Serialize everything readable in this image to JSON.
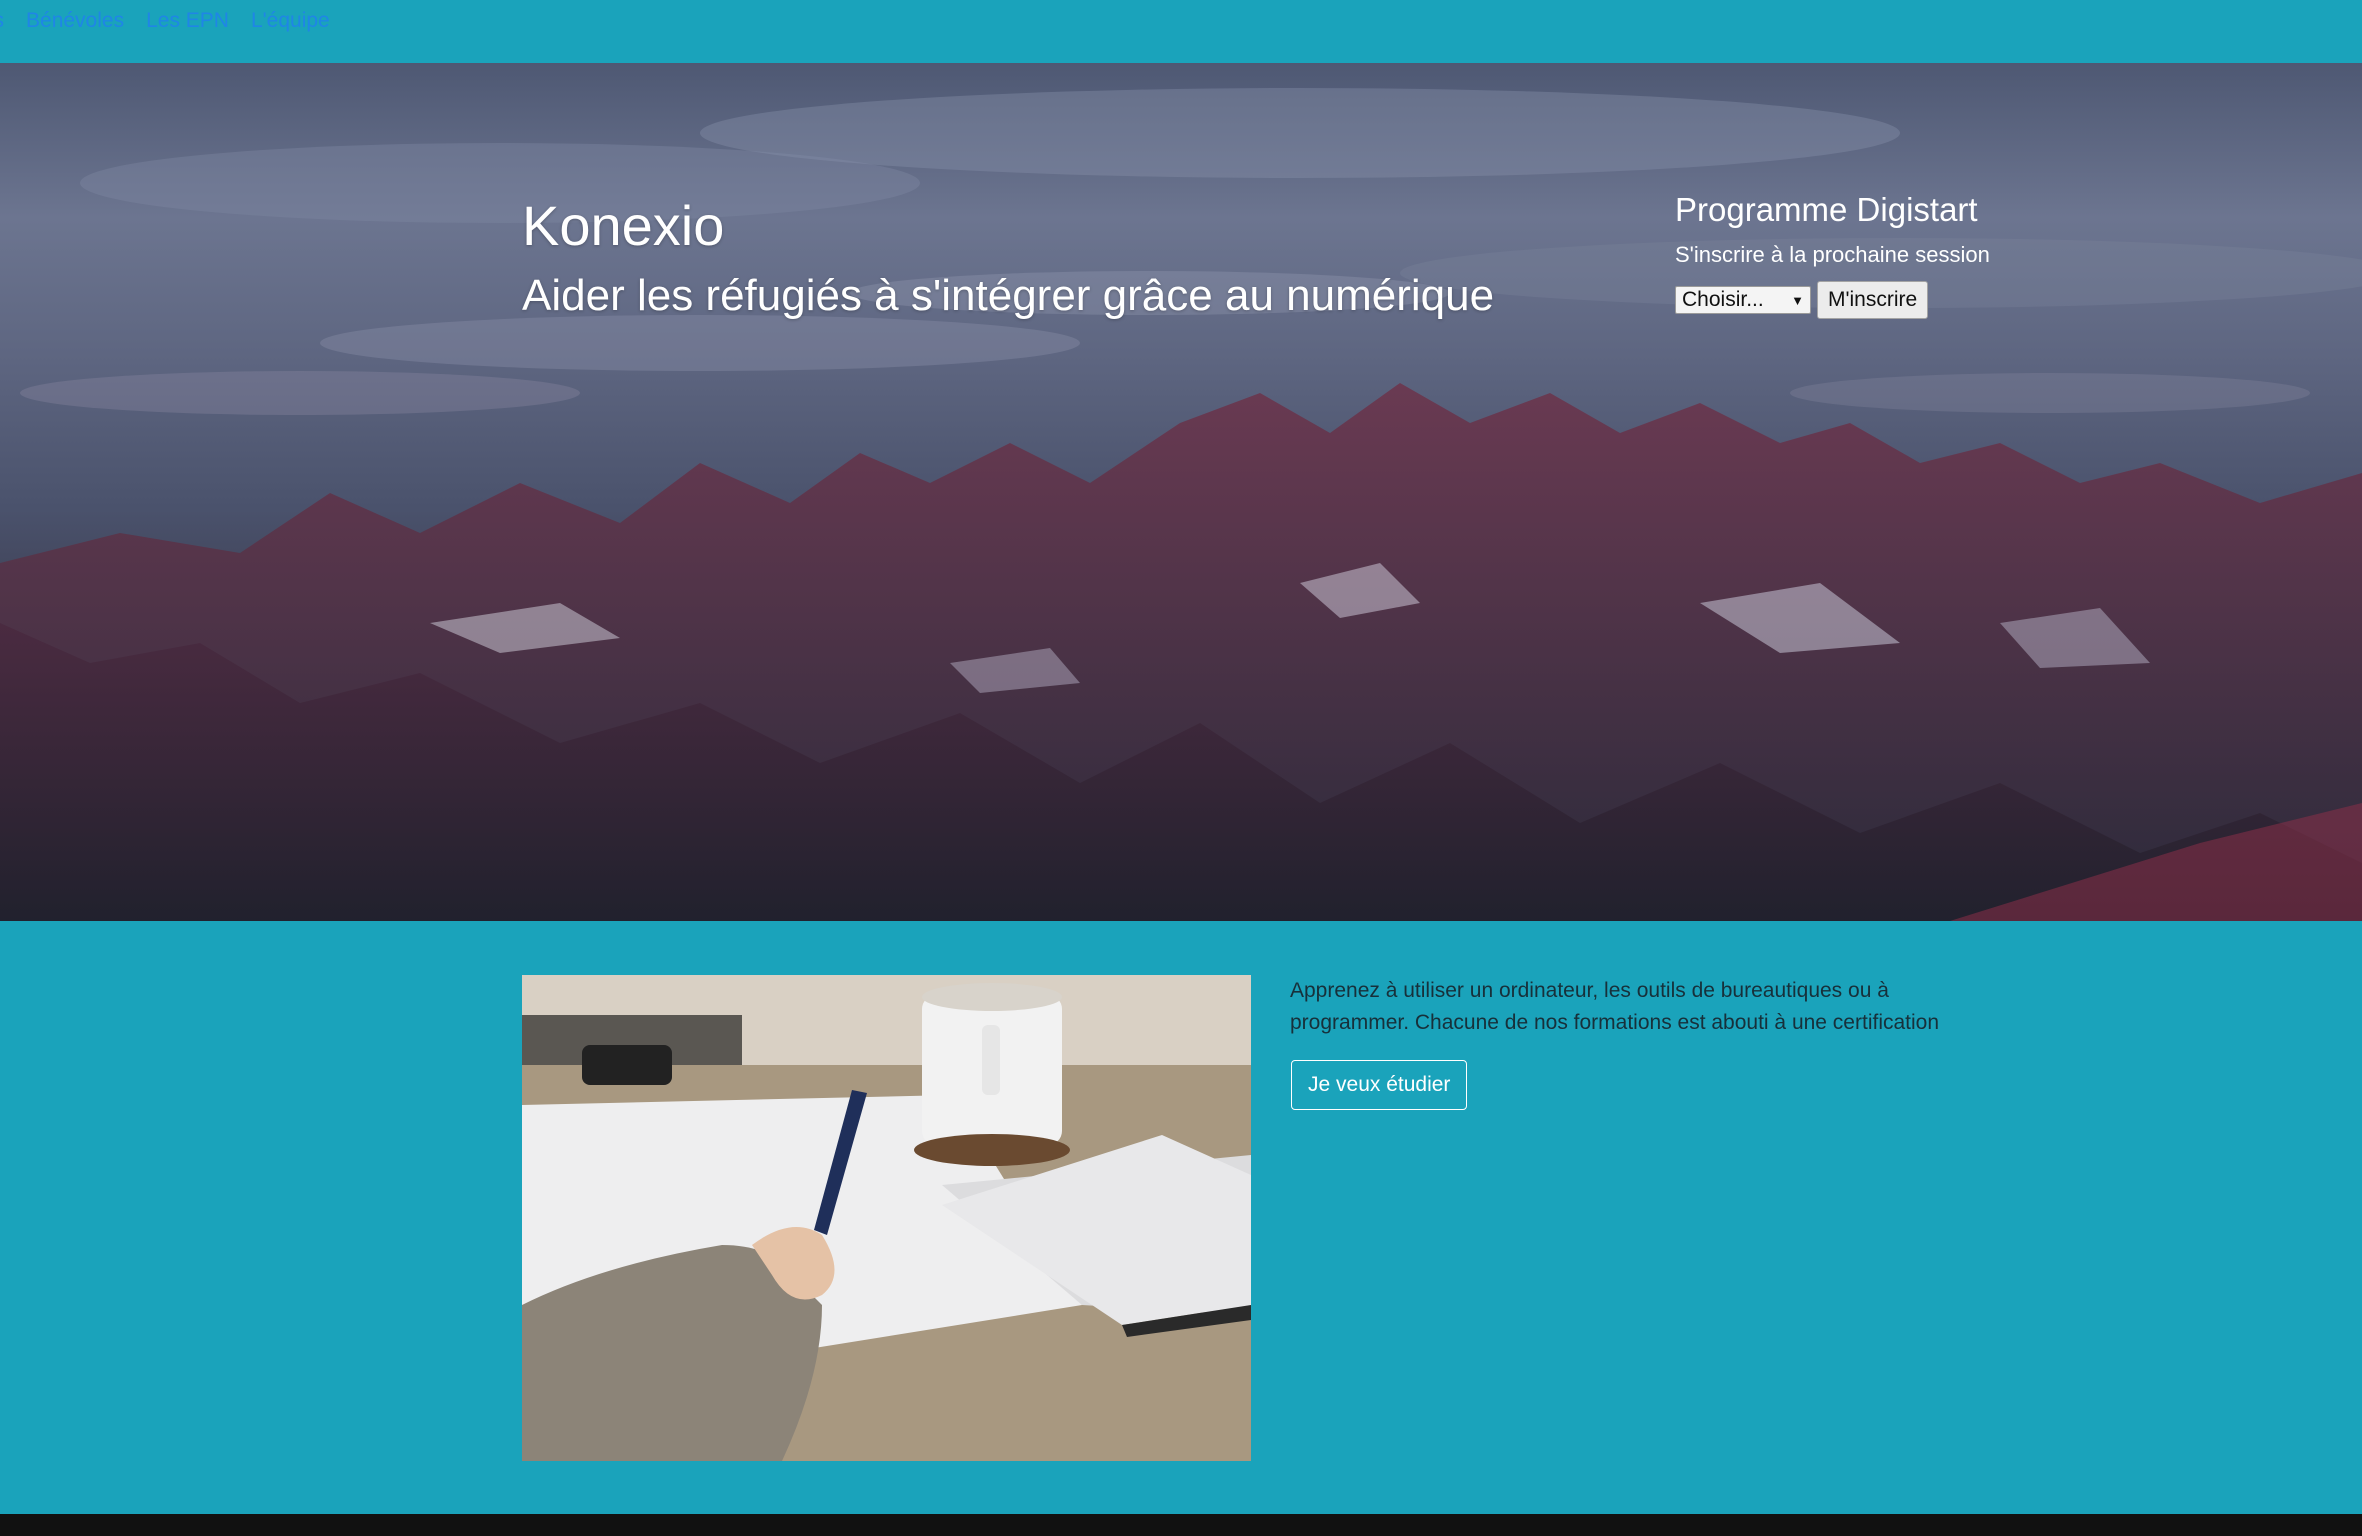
{
  "nav": {
    "items": [
      {
        "label": "nts"
      },
      {
        "label": "Bénévoles"
      },
      {
        "label": "Les EPN"
      },
      {
        "label": "L'équipe"
      }
    ]
  },
  "hero": {
    "title": "Konexio",
    "subtitle": "Aider les réfugiés à s'intégrer grâce au numérique"
  },
  "signup": {
    "title": "Programme Digistart",
    "subtitle": "S'inscrire à la prochaine session",
    "select_value": "Choisir...",
    "button_label": "M'inscrire"
  },
  "feature": {
    "text": "Apprenez à utiliser un ordinateur, les outils de bureautiques ou à programmer. Chacune de nos formations est abouti à une certification",
    "button_label": "Je veux étudier"
  },
  "colors": {
    "page_background": "#1aa3bb",
    "nav_link": "#1f86e6",
    "footer": "#111111"
  }
}
